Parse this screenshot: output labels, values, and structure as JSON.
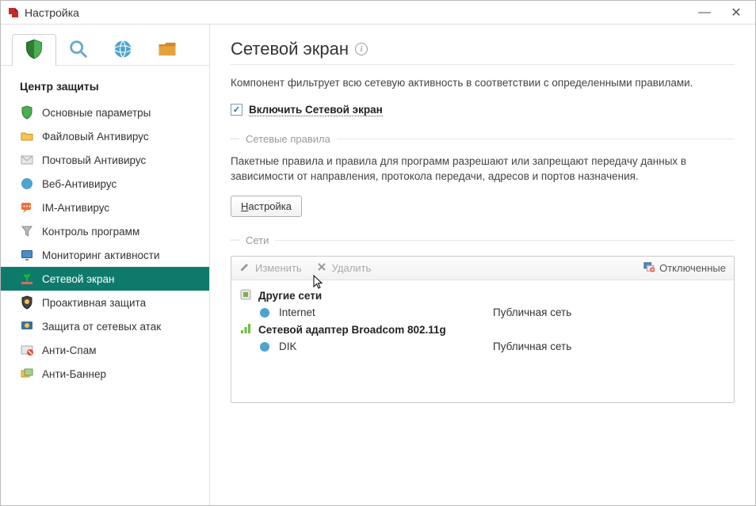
{
  "titlebar": {
    "title": "Настройка"
  },
  "sidebar": {
    "section_title": "Центр защиты",
    "items": [
      {
        "label": "Основные параметры"
      },
      {
        "label": "Файловый Антивирус"
      },
      {
        "label": "Почтовый Антивирус"
      },
      {
        "label": "Веб-Антивирус"
      },
      {
        "label": "IM-Антивирус"
      },
      {
        "label": "Контроль программ"
      },
      {
        "label": "Мониторинг активности"
      },
      {
        "label": "Сетевой экран"
      },
      {
        "label": "Проактивная защита"
      },
      {
        "label": "Защита от сетевых атак"
      },
      {
        "label": "Анти-Спам"
      },
      {
        "label": "Анти-Баннер"
      }
    ]
  },
  "main": {
    "title": "Сетевой экран",
    "description": "Компонент фильтрует всю сетевую активность в соответствии с определенными правилами.",
    "enable_label": "Включить Сетевой экран",
    "rules_section_label": "Сетевые правила",
    "rules_text": "Пакетные правила и правила для программ разрешают или запрещают передачу данных в зависимости от направления, протокола передачи, адресов и портов назначения.",
    "configure_btn": "Настройка",
    "networks_section_label": "Сети",
    "toolbar": {
      "edit": "Изменить",
      "delete": "Удалить",
      "disconnected": "Отключенные"
    },
    "net_groups": [
      {
        "title": "Другие сети",
        "rows": [
          {
            "name": "Internet",
            "type": "Публичная сеть"
          }
        ]
      },
      {
        "title": "Сетевой адаптер Broadcom 802.11g",
        "rows": [
          {
            "name": "DIK",
            "type": "Публичная сеть"
          }
        ]
      }
    ]
  }
}
